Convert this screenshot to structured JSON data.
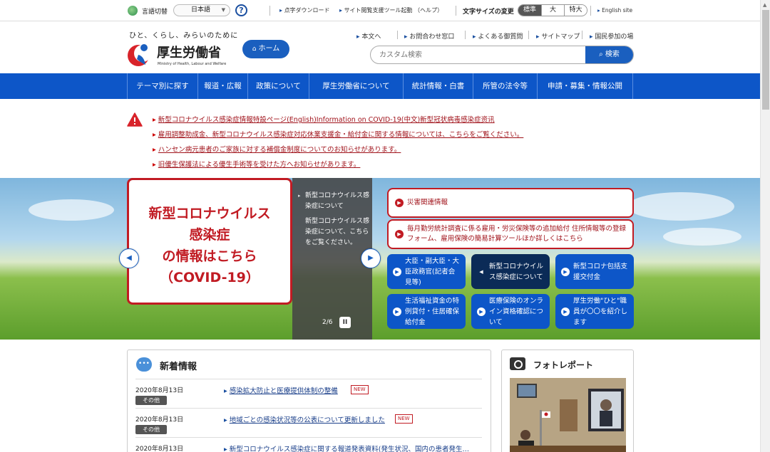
{
  "utility": {
    "lang_label": "言語切替",
    "lang_value": "日本語",
    "help": "?",
    "links": [
      "点字ダウンロード",
      "サイト閲覧支援ツール起動 （ヘルプ）"
    ],
    "font_size_label": "文字サイズの変更",
    "font_sizes": [
      "標準",
      "大",
      "特大"
    ],
    "english": "English site"
  },
  "header": {
    "tagline": "ひと、くらし、みらいのために",
    "logo_name": "厚生労働省",
    "logo_sub": "Ministry of Health, Labour and Welfare",
    "home": "ホーム",
    "links": [
      "本文へ",
      "お問合わせ窓口",
      "よくある御質問",
      "サイトマップ",
      "国民参加の場"
    ],
    "search_placeholder": "カスタム検索",
    "search_button": "検索"
  },
  "nav": [
    "テーマ別に探す",
    "報道・広報",
    "政策について",
    "厚生労働省について",
    "統計情報・白書",
    "所管の法令等",
    "申請・募集・情報公開"
  ],
  "alerts": [
    "新型コロナウイルス感染症情報特設ページ(English)Information on COVID-19(中文)新型冠状病毒感染症资讯",
    "雇用調整助成金、新型コロナウイルス感染症対応休業支援金・給付金に関する情報については、こちらをご覧ください。",
    "ハンセン病元患者のご家族に対する補償金制度についてのお知らせがあります。",
    "旧優生保護法による優生手術等を受けた方へお知らせがあります。"
  ],
  "hero": {
    "banner_lines": [
      "新型コロナウイルス",
      "感染症",
      "の情報はこちら",
      "（COVID-19）"
    ],
    "captions": [
      "新型コロナウイルス感染症について",
      "新型コロナウイルス感染症について、こちらをご覧ください。"
    ],
    "counter": "2/6",
    "pause": "II"
  },
  "pills": [
    "災害関連情報",
    "毎月勤労統計調査に係る雇用・労災保険等の追加給付 住所情報等の登録フォーム、雇用保険の簡易計算ツールほか詳しくはこちら"
  ],
  "tiles": [
    "大臣・副大臣・大臣政務官(記者会見等)",
    "新型コロナウイルス感染症について",
    "新型コロナ包括支援交付金",
    "生活福祉資金の特例貸付・住居確保給付金",
    "医療保険のオンライン資格確認について",
    "厚生労働\"ひと\"職員が〇〇を紹介します"
  ],
  "news": {
    "title": "新着情報",
    "items": [
      {
        "date": "2020年8月13日",
        "tag": "その他",
        "text": "感染拡大防止と医療提供体制の整備",
        "new": "NEW"
      },
      {
        "date": "2020年8月13日",
        "tag": "その他",
        "text": "地域ごとの感染状況等の公表について更新しました",
        "new": "NEW"
      },
      {
        "date": "2020年8月13日",
        "tag": "",
        "text": "新型コロナウイルス感染症に関する報道発表資料(発生状況、国内の患者発生…",
        "new": ""
      }
    ]
  },
  "photo": {
    "title": "フォトレポート"
  }
}
